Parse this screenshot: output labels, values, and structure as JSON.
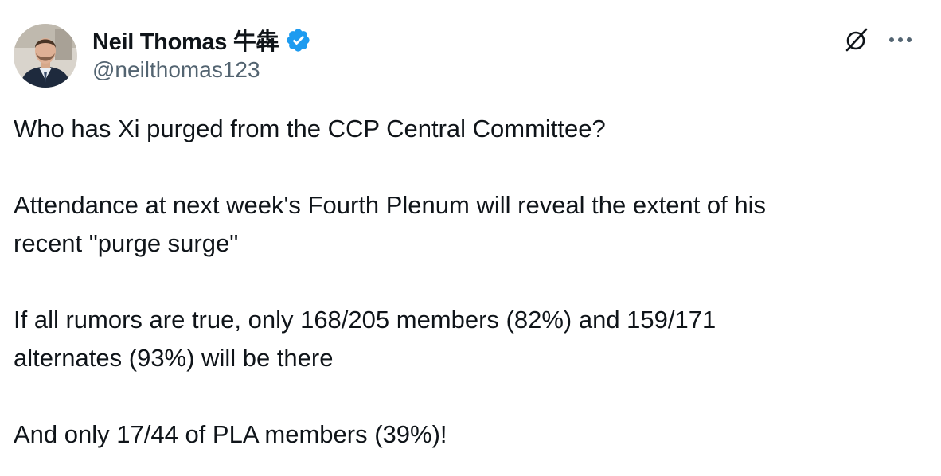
{
  "author": {
    "name": "Neil Thomas 牛犇",
    "handle": "@neilthomas123",
    "verified": true,
    "verified_color": "#1d9bf0",
    "avatar_icon": "profile-photo"
  },
  "actions": {
    "grok_icon": "grok-icon",
    "more_icon": "more-horizontal-icon"
  },
  "tweet": {
    "paragraphs": [
      "Who has Xi purged from the CCP Central Committee?",
      "Attendance at next week's Fourth Plenum will reveal the extent of his\nrecent \"purge surge\"",
      "If all rumors are true, only 168/205 members (82%) and 159/171\nalternates (93%) will be there",
      "And only 17/44 of PLA members (39%)!"
    ]
  },
  "colors": {
    "text": "#0f1419",
    "secondary_text": "#536471",
    "background": "#ffffff"
  }
}
